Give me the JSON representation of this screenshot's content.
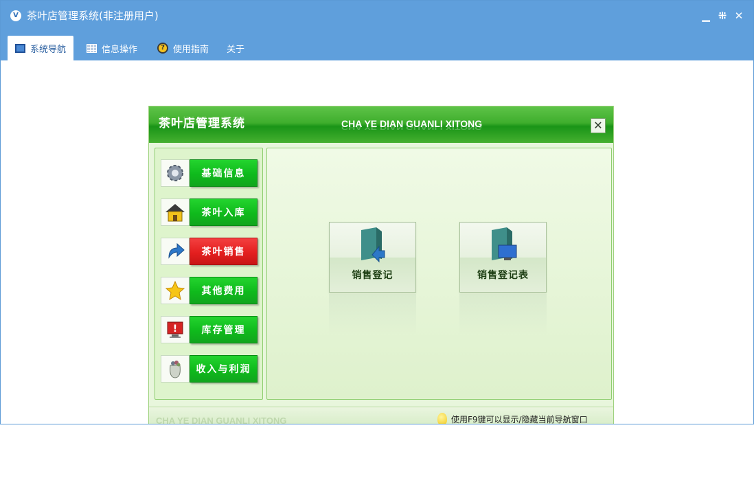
{
  "window": {
    "title": "茶叶店管理系统(非注册用户)",
    "controls": [
      "minimize",
      "restore",
      "close"
    ]
  },
  "menu": {
    "tabs": [
      {
        "label": "系统导航",
        "icon": "monitor-icon",
        "active": true
      },
      {
        "label": "信息操作",
        "icon": "grid-icon",
        "active": false
      },
      {
        "label": "使用指南",
        "icon": "help-icon",
        "active": false
      },
      {
        "label": "关于",
        "icon": "",
        "active": false
      }
    ]
  },
  "dialog": {
    "title": "茶叶店管理系统",
    "subtitle": "CHA YE DIAN GUANLI XITONG",
    "close_label": "✕",
    "nav": [
      {
        "label": "基础信息",
        "icon": "gear-icon"
      },
      {
        "label": "茶叶入库",
        "icon": "house-icon"
      },
      {
        "label": "茶叶销售",
        "icon": "arrow-icon",
        "active": true
      },
      {
        "label": "其他费用",
        "icon": "star-icon"
      },
      {
        "label": "库存管理",
        "icon": "alert-monitor-icon"
      },
      {
        "label": "收入与利润",
        "icon": "bag-icon"
      }
    ],
    "tiles": [
      {
        "label": "销售登记",
        "icon": "door-arrow-icon"
      },
      {
        "label": "销售登记表",
        "icon": "door-monitor-icon"
      }
    ],
    "footer": {
      "brand": "CHA YE DIAN GUANLI XITONG",
      "hint": "使用F9键可以显示/隐藏当前导航窗口"
    }
  },
  "colors": {
    "titlebar": "#5f9fdc",
    "header_green": "#199417",
    "button_green": "#0fba1c",
    "button_red": "#e41f1f",
    "panel_bg": "#e8f6dc"
  }
}
